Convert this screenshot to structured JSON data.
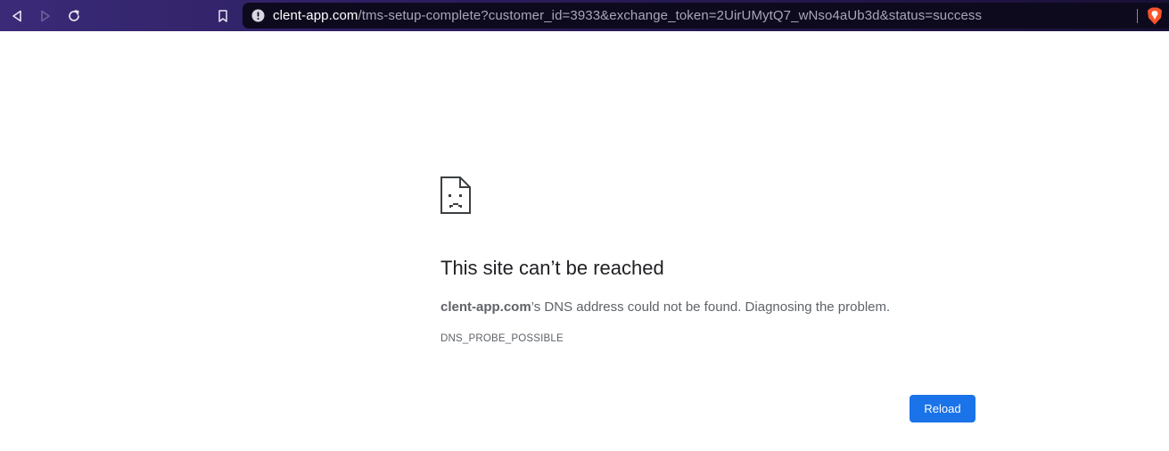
{
  "browser": {
    "url_host": "clent-app.com",
    "url_path": "/tms-setup-complete?customer_id=3933&exchange_token=2UirUMytQ7_wNso4aUb3d&status=success",
    "icons": {
      "back": "back-arrow-icon",
      "forward": "forward-arrow-icon",
      "reload": "reload-icon",
      "bookmark": "bookmark-icon",
      "site_info": "site-info-icon",
      "brave_shield": "brave-shield-icon"
    }
  },
  "error_page": {
    "title": "This site can’t be reached",
    "host": "clent-app.com",
    "message_suffix": "’s DNS address could not be found. Diagnosing the problem.",
    "error_code": "DNS_PROBE_POSSIBLE",
    "reload_label": "Reload"
  },
  "colors": {
    "reload_button": "#1a73e8",
    "title_text": "#202124",
    "body_text": "#5f6368"
  }
}
